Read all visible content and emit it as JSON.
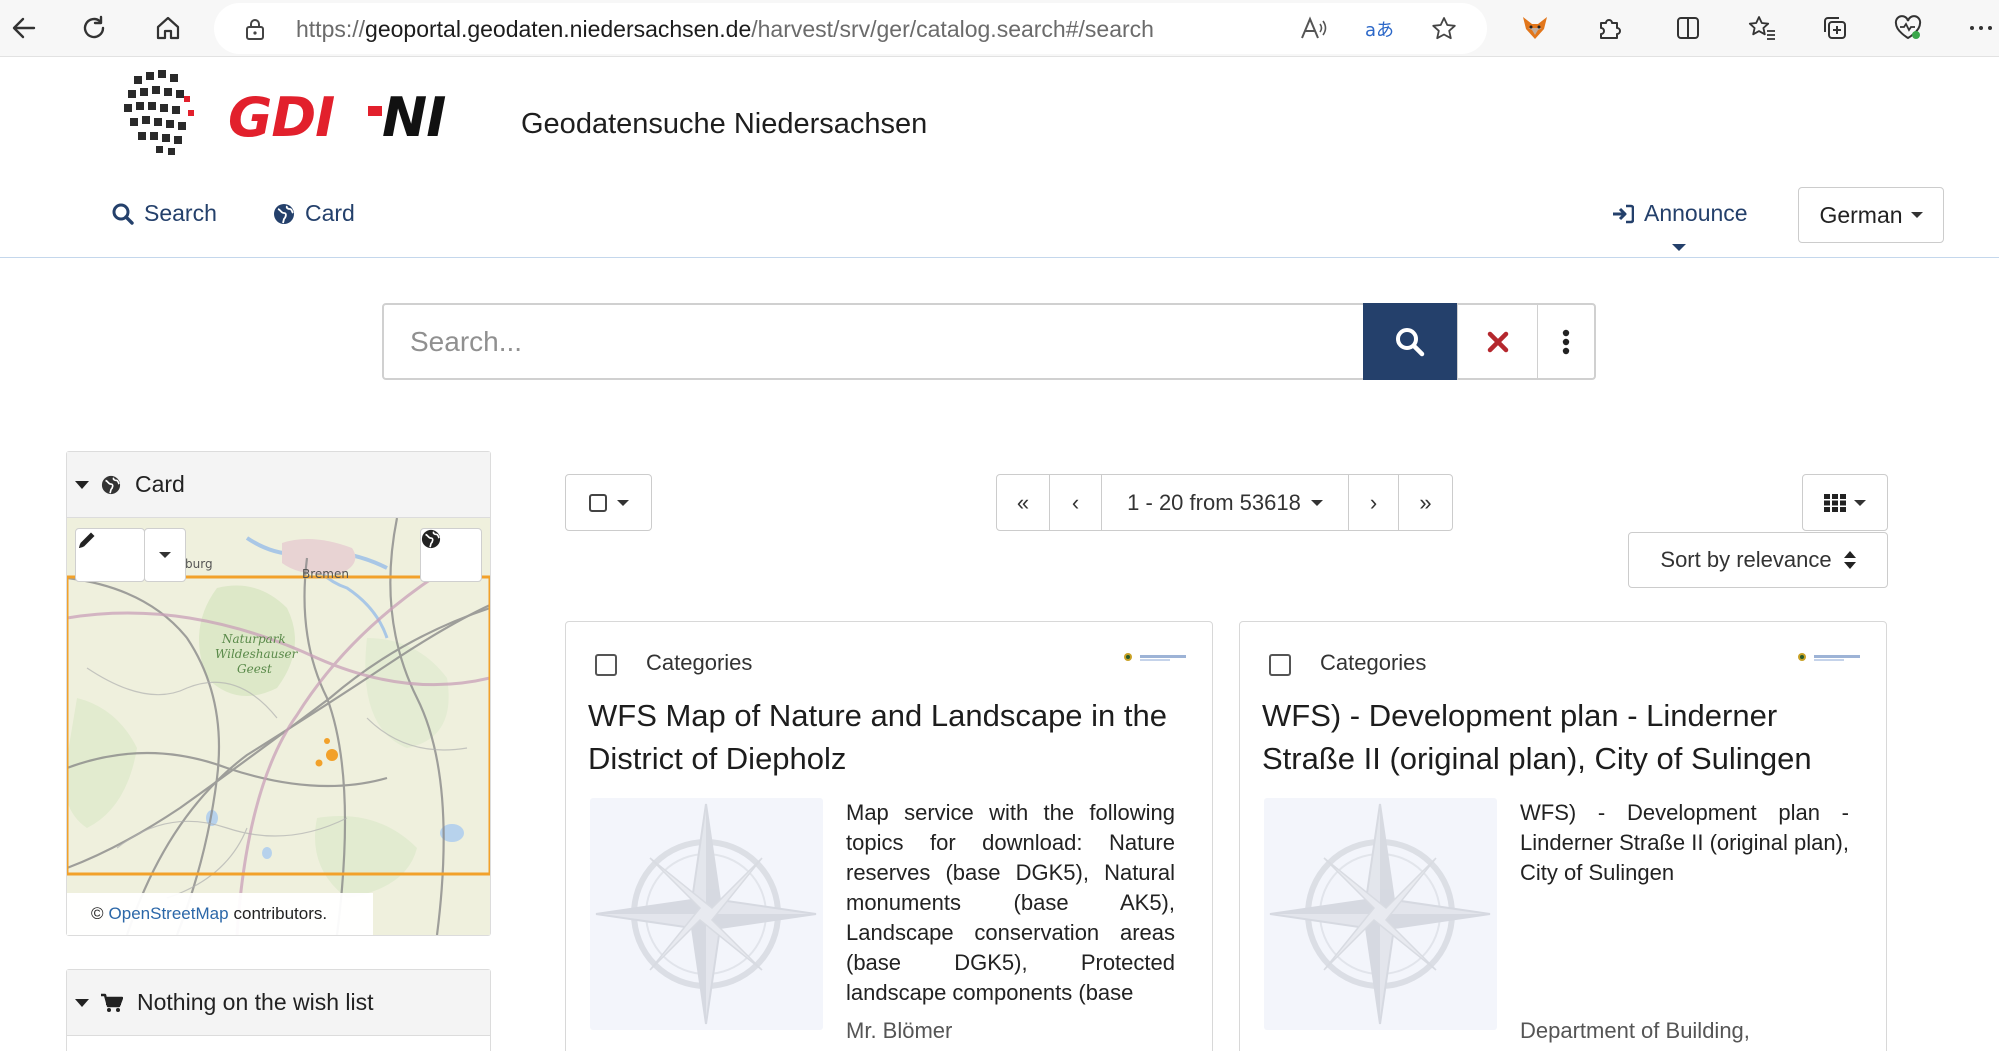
{
  "browser": {
    "url_prefix": "https://",
    "url_host": "geoportal.geodaten.niedersachsen.de",
    "url_path": "/harvest/srv/ger/catalog.search#/search"
  },
  "header": {
    "logo_text": "GDI-NI",
    "site_title": "Geodatensuche Niedersachsen"
  },
  "nav": {
    "search_label": "Search",
    "card_label": "Card",
    "announce_label": "Announce",
    "language_label": "German"
  },
  "search": {
    "placeholder": "Search..."
  },
  "sidebar": {
    "map_panel_title": "Card",
    "map_labels": [
      "burg",
      "Bremen",
      "Naturpark",
      "Wildeshauser",
      "Geest"
    ],
    "attribution_prefix": "©",
    "attribution_link": "OpenStreetMap",
    "attribution_suffix": "contributors.",
    "wishlist_title": "Nothing on the wish list"
  },
  "toolbar": {
    "pager_label": "1 - 20 from 53618",
    "sort_label": "Sort by relevance"
  },
  "results": [
    {
      "category": "Categories",
      "title": "WFS Map of Nature and Landscape in the District of Diepholz",
      "description": "Map service with the following topics for download: Nature reserves (base DGK5), Natural monuments (base AK5), Landscape conservation areas (base DGK5), Protected landscape components (base",
      "author": "Mr. Blömer"
    },
    {
      "category": "Categories",
      "title": "WFS) - Development plan - Linderner Straße II (original plan), City of Sulingen",
      "description": "WFS) - Development plan - Linderner Straße II (original plan), City of Sulingen",
      "author": "Department of Building,"
    }
  ],
  "colors": {
    "brand_red": "#e2202c",
    "nav_blue": "#24406b",
    "link_blue": "#2b67a8",
    "map_bbox": "#f2a12a",
    "clear_red": "#b5282e"
  }
}
